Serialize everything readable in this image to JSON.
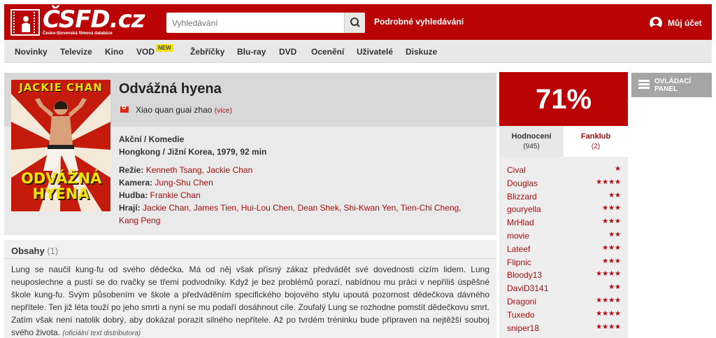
{
  "brand": {
    "name": "CSFD.cz",
    "logo_text": "ČSFD.cz",
    "subtitle": "Česko-Slovenská filmová databáze",
    "color": "#ba0305"
  },
  "header": {
    "search": {
      "placeholder": "Vyhledávání",
      "value": "",
      "icon": "search-icon"
    },
    "advanced_search": "Podrobné vyhledávání",
    "account_label": "Můj účet",
    "account_icon": "user-icon"
  },
  "nav": {
    "items": [
      {
        "label": "Novinky"
      },
      {
        "label": "Televize"
      },
      {
        "label": "Kino"
      },
      {
        "label": "VOD",
        "badge": "NEW"
      },
      {
        "label": "Žebříčky"
      },
      {
        "label": "Blu-ray"
      },
      {
        "label": "DVD"
      },
      {
        "label": "Ocenění"
      },
      {
        "label": "Uživatelé"
      },
      {
        "label": "Diskuze"
      }
    ]
  },
  "film": {
    "title": "Odvážná hyena",
    "alt_title": "Xiao quan guai zhao",
    "alt_more": "(více)",
    "alt_flag": "hongkong-flag-icon",
    "poster_text_top": "JACKIE CHAN",
    "poster_text_bottom": "ODVÁŽNÁ HYENA",
    "genre": "Akční / Komedie",
    "origin": "Hongkong / Jižní Korea, 1979, 92 min",
    "crew": [
      {
        "label": "Režie:",
        "people": "Kenneth Tsang, Jackie Chan"
      },
      {
        "label": "Kamera:",
        "people": "Jung-Shu Chen"
      },
      {
        "label": "Hudba:",
        "people": "Frankie Chan"
      },
      {
        "label": "Hrají:",
        "people": "Jackie Chan, James Tien, Hui-Lou Chen, Dean Shek, Shi-Kwan Yen, Tien-Chi Cheng,",
        "people_line2": "Kang Peng"
      }
    ]
  },
  "plot": {
    "title": "Obsahy",
    "count": "(1)",
    "text": "Lung se naučil kung-fu od svého dědečka. Má od něj však přísný zákaz předvádět své dovednosti cizím lidem. Lung neuposlechne a pustí se do rvačky se třemi podvodníky. Když je bez problémů porazí, nabídnou mu práci v nepříliš úspěšné škole kung-fu. Svým působením ve škole a předváděním specifického bojového stylu upoutá pozornost dědečkova dávného nepřítele. Ten již léta touží po jeho smrti a nyní se mu podaří dosáhnout cíle. Zoufalý Lung se rozhodne pomstít dědečkovu smrt. Zatím však není natolik dobrý, aby dokázal porazit silného nepřítele. Až po tvrdém tréninku bude připraven na nejtěžší souboj svého života.",
    "source": "(oficiální text distributora)"
  },
  "rating": {
    "percent": "71%",
    "tabs": [
      {
        "label": "Hodnocení",
        "count": "(945)"
      },
      {
        "label": "Fanklub",
        "count": "(2)"
      }
    ],
    "users": [
      {
        "name": "Cival",
        "stars": "★"
      },
      {
        "name": "Douglas",
        "stars": "★★★★"
      },
      {
        "name": "Blizzard",
        "stars": "★★"
      },
      {
        "name": "gouryella",
        "stars": "★★★"
      },
      {
        "name": "MrHlad",
        "stars": "★★★"
      },
      {
        "name": "movie",
        "stars": "★★"
      },
      {
        "name": "Lateef",
        "stars": "★★★"
      },
      {
        "name": "Flipnic",
        "stars": "★★★"
      },
      {
        "name": "Bloody13",
        "stars": "★★★★"
      },
      {
        "name": "DaviD3141",
        "stars": "★★"
      },
      {
        "name": "Dragoni",
        "stars": "★★★★"
      },
      {
        "name": "Tuxedo",
        "stars": "★★★★"
      },
      {
        "name": "sniper18",
        "stars": "★★★★"
      }
    ]
  },
  "control_panel": {
    "line1": "OVLÁDACÍ",
    "line2": "PANEL",
    "icon": "menu-lines-icon"
  }
}
